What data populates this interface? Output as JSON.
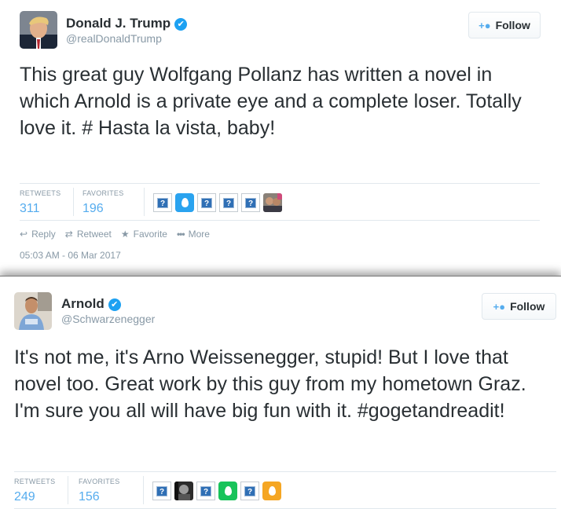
{
  "tweet1": {
    "display_name": "Donald J. Trump",
    "handle": "@realDonaldTrump",
    "follow_label": "Follow",
    "text": "This great guy Wolfgang Pollanz has written a novel in which Arnold is a private eye and a complete loser. Totally love it. # Hasta la vista, baby!",
    "retweets_label": "RETWEETS",
    "retweets_count": "311",
    "favorites_label": "FAVORITES",
    "favorites_count": "196",
    "actions": {
      "reply": "Reply",
      "retweet": "Retweet",
      "favorite": "Favorite",
      "more": "More"
    },
    "timestamp": "05:03 AM - 06 Mar 2017"
  },
  "tweet2": {
    "display_name": "Arnold",
    "handle": "@Schwarzenegger",
    "follow_label": "Follow",
    "text": "It's not me, it's Arno Weissenegger, stupid! But I love that novel too. Great work by this guy from my hometown Graz. I'm sure you all will have big fun with it. #gogetandreadit!",
    "retweets_label": "RETWEETS",
    "retweets_count": "249",
    "favorites_label": "FAVORITES",
    "favorites_count": "156"
  },
  "icons": {
    "verified": "✔",
    "follow": "+👤",
    "reply": "↩",
    "retweet": "⇄",
    "favorite": "★",
    "more": "•••",
    "missing_image": "?"
  },
  "colors": {
    "accent": "#55acee",
    "verified": "#1da1f2",
    "egg_blue": "#2aa3ef",
    "egg_green": "#18c35a",
    "egg_orange": "#f5a623"
  }
}
